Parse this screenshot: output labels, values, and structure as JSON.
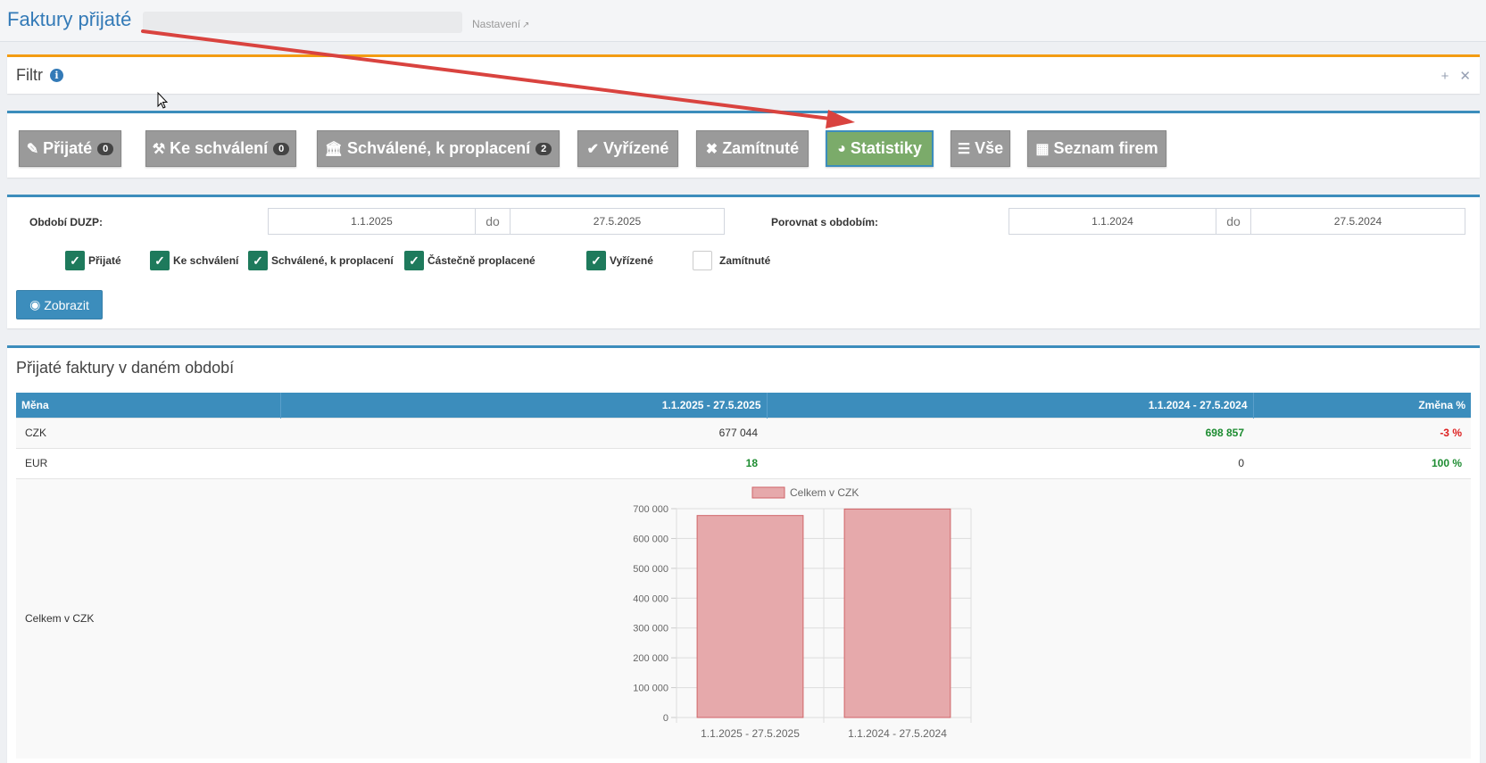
{
  "header": {
    "title": "Faktury přijaté",
    "settings_label": "Nastavení"
  },
  "filter": {
    "title": "Filtr",
    "info_icon": "info-circle-icon",
    "expand_icon": "plus-icon",
    "close_icon": "close-icon"
  },
  "tabs": [
    {
      "label": "Přijaté",
      "badge": "0",
      "icon": "edit-icon"
    },
    {
      "label": "Ke schválení",
      "badge": "0",
      "icon": "gavel-icon"
    },
    {
      "label": "Schválené, k proplacení",
      "badge": "2",
      "icon": "bank-icon"
    },
    {
      "label": "Vyřízené",
      "icon": "check-icon"
    },
    {
      "label": "Zamítnuté",
      "icon": "times-icon"
    },
    {
      "label": "Statistiky",
      "icon": "pie-chart-icon",
      "active": true
    },
    {
      "label": "Vše",
      "icon": "list-icon"
    },
    {
      "label": "Seznam firem",
      "icon": "building-icon"
    }
  ],
  "form": {
    "period_label": "Období DUZP:",
    "period_from": "1.1.2025",
    "period_sep": "do",
    "period_to": "27.5.2025",
    "compare_label": "Porovnat s obdobím:",
    "compare_from": "1.1.2024",
    "compare_sep": "do",
    "compare_to": "27.5.2024",
    "checkboxes": [
      {
        "label": "Přijaté",
        "checked": true
      },
      {
        "label": "Ke schválení",
        "checked": true
      },
      {
        "label": "Schválené, k proplacení",
        "checked": true
      },
      {
        "label": "Částečně proplacené",
        "checked": true
      },
      {
        "label": "Vyřízené",
        "checked": true
      },
      {
        "label": "Zamítnuté",
        "checked": false
      }
    ],
    "show_button": "Zobrazit"
  },
  "stats": {
    "title": "Přijaté faktury v daném období",
    "columns": [
      "Měna",
      "1.1.2025 - 27.5.2025",
      "1.1.2024 - 27.5.2024",
      "Změna %"
    ],
    "rows": [
      {
        "currency": "CZK",
        "current": "677 044",
        "previous": "698 857",
        "change": "-3 %"
      },
      {
        "currency": "EUR",
        "current": "18",
        "previous": "0",
        "change": "100 %"
      }
    ],
    "chart_row_label": "Celkem v CZK"
  },
  "colors": {
    "primary": "#3c8dbc",
    "active_tab": "#7bab6a",
    "tab": "#9a9a9a",
    "bar": "#e6a9ab",
    "positive": "#1d8c31",
    "negative": "#dd1e1e"
  },
  "chart_data": {
    "type": "bar",
    "categories": [
      "1.1.2025 - 27.5.2025",
      "1.1.2024 - 27.5.2024"
    ],
    "series": [
      {
        "name": "Celkem v CZK",
        "values": [
          677044,
          698857
        ]
      }
    ],
    "ylim": [
      0,
      700000
    ],
    "yticks": [
      0,
      100000,
      200000,
      300000,
      400000,
      500000,
      600000,
      700000
    ],
    "ytick_labels": [
      "0",
      "100 000",
      "200 000",
      "300 000",
      "400 000",
      "500 000",
      "600 000",
      "700 000"
    ],
    "grid": true,
    "legend": "top"
  }
}
